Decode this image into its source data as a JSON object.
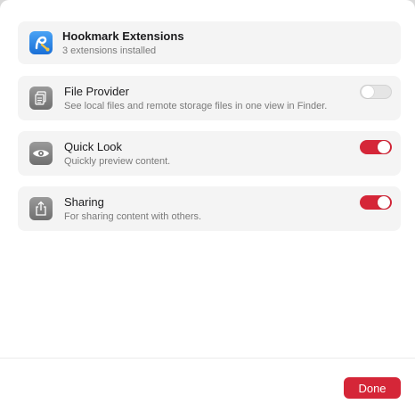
{
  "header": {
    "title": "Hookmark Extensions",
    "subtitle": "3 extensions installed",
    "icon": "hookmark-app-icon"
  },
  "extensions": [
    {
      "title": "File Provider",
      "description": "See local files and remote storage files in one view in Finder.",
      "icon": "documents-icon",
      "enabled": false
    },
    {
      "title": "Quick Look",
      "description": "Quickly preview content.",
      "icon": "eye-icon",
      "enabled": true
    },
    {
      "title": "Sharing",
      "description": "For sharing content with others.",
      "icon": "share-icon",
      "enabled": true
    }
  ],
  "footer": {
    "done_label": "Done"
  },
  "colors": {
    "accent": "#d52638",
    "card": "#f4f4f4",
    "toggle_off": "#e5e5e5"
  }
}
